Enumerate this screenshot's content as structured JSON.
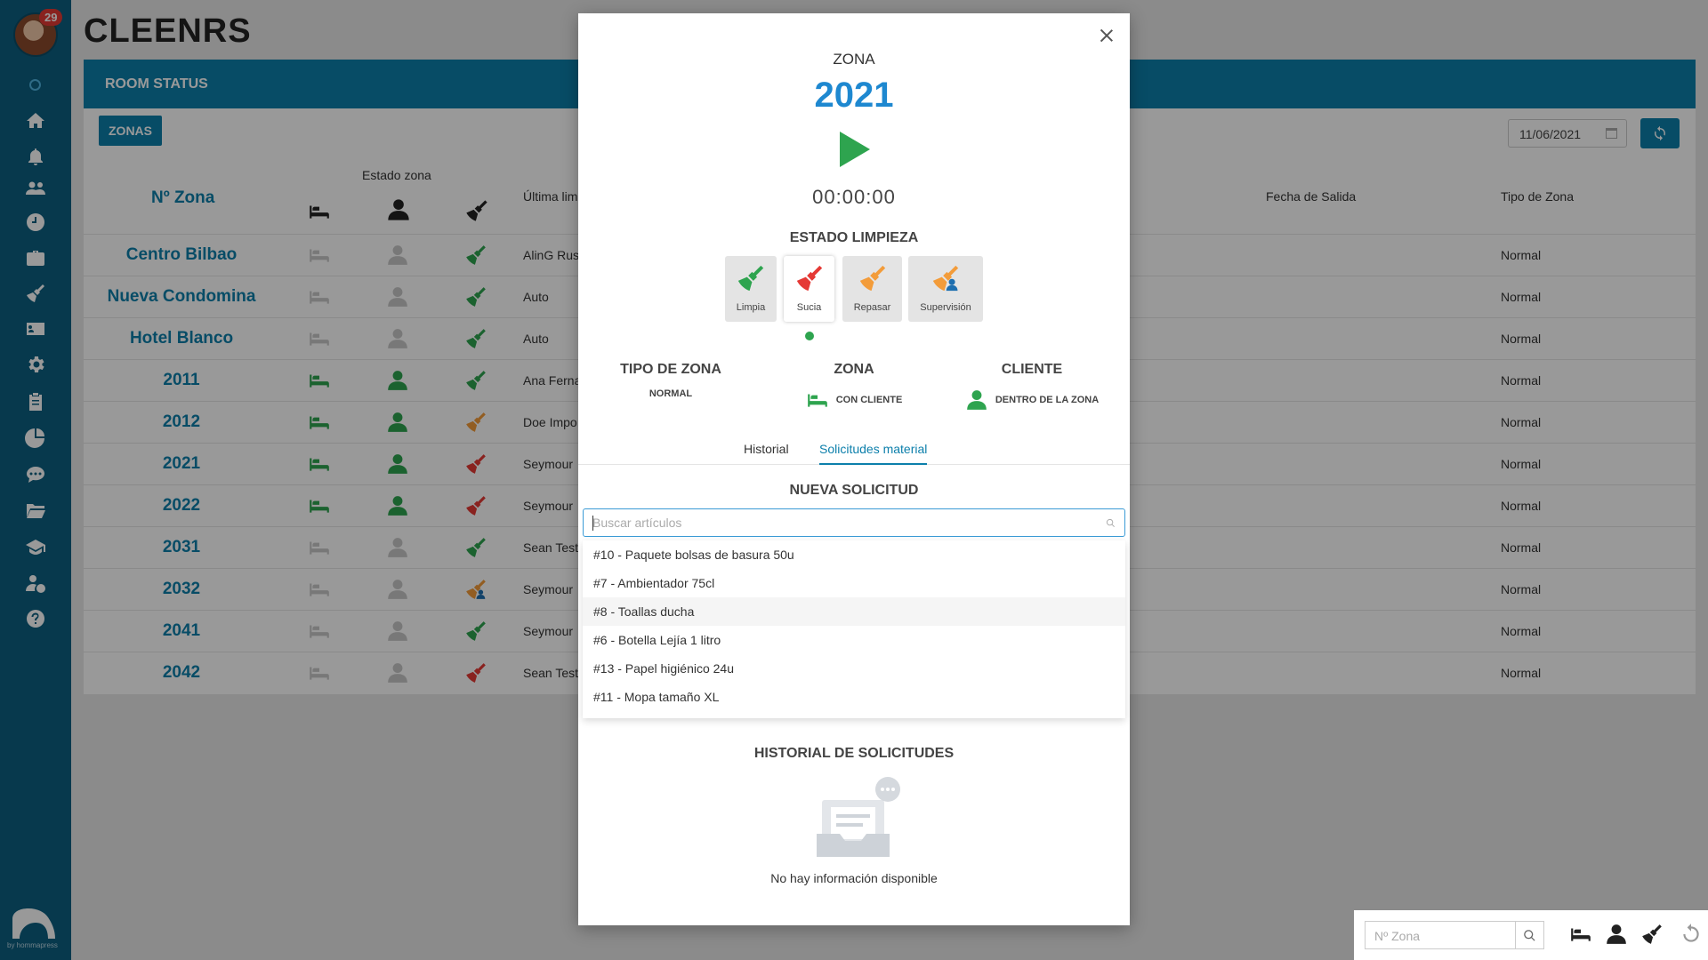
{
  "app": {
    "title": "CLEENRS",
    "notifications_count": "29",
    "vendor": "by hommapress"
  },
  "panel": {
    "title": "ROOM STATUS",
    "zonas_button": "ZONAS",
    "date": "11/06/2021"
  },
  "table": {
    "headers": {
      "zona": "Nº Zona",
      "estado_zona": "Estado zona",
      "ultima": "Última lim",
      "fecha_salida": "Fecha de Salida",
      "tipo_zona": "Tipo de Zona"
    },
    "rows": [
      {
        "zona": "Centro Bilbao",
        "bed": "inactive",
        "person": "inactive",
        "clean": "green",
        "ultima": "AlinG Rus",
        "tipo": "Normal"
      },
      {
        "zona": "Nueva Condomina",
        "bed": "inactive",
        "person": "inactive",
        "clean": "green",
        "ultima": "Auto",
        "tipo": "Normal"
      },
      {
        "zona": "Hotel Blanco",
        "bed": "inactive",
        "person": "inactive",
        "clean": "green",
        "ultima": "Auto",
        "tipo": "Normal"
      },
      {
        "zona": "2011",
        "bed": "active",
        "person": "active",
        "clean": "green",
        "ultima": "Ana Ferna",
        "tipo": "Normal"
      },
      {
        "zona": "2012",
        "bed": "active",
        "person": "active",
        "clean": "orange",
        "ultima": "Doe Impo",
        "tipo": "Normal"
      },
      {
        "zona": "2021",
        "bed": "active",
        "person": "active",
        "clean": "red",
        "ultima": "Seymour",
        "tipo": "Normal"
      },
      {
        "zona": "2022",
        "bed": "active",
        "person": "active",
        "clean": "red",
        "ultima": "Seymour",
        "tipo": "Normal"
      },
      {
        "zona": "2031",
        "bed": "inactive",
        "person": "inactive",
        "clean": "green",
        "ultima": "Sean Test",
        "tipo": "Normal"
      },
      {
        "zona": "2032",
        "bed": "inactive",
        "person": "inactive",
        "clean": "orange-blue",
        "ultima": "Seymour",
        "tipo": "Normal"
      },
      {
        "zona": "2041",
        "bed": "inactive",
        "person": "inactive",
        "clean": "green",
        "ultima": "Seymour",
        "tipo": "Normal"
      },
      {
        "zona": "2042",
        "bed": "inactive",
        "person": "inactive",
        "clean": "red",
        "ultima": "Sean Test",
        "tipo": "Normal"
      }
    ]
  },
  "filter": {
    "placeholder": "Nº Zona"
  },
  "modal": {
    "zona_label": "ZONA",
    "zona_number": "2021",
    "timer": "00:00:00",
    "estado_title": "ESTADO LIMPIEZA",
    "estado_options": [
      "Limpia",
      "Sucia",
      "Repasar",
      "Supervisión"
    ],
    "estado_selected": "Sucia",
    "tipo_zona_label": "TIPO DE ZONA",
    "tipo_zona_value": "NORMAL",
    "zona_status_label": "ZONA",
    "zona_status_value": "CON CLIENTE",
    "cliente_label": "CLIENTE",
    "cliente_value": "DENTRO DE LA ZONA",
    "tabs": [
      "Historial",
      "Solicitudes material"
    ],
    "active_tab": "Solicitudes material",
    "nueva_title": "NUEVA SOLICITUD",
    "search_placeholder": "Buscar artículos",
    "articles": [
      "#10 - Paquete bolsas de basura 50u",
      "#7 - Ambientador 75cl",
      "#8 - Toallas ducha",
      "#6 - Botella Lejía 1 litro",
      "#13 - Papel higiénico 24u",
      "#11 - Mopa tamaño XL"
    ],
    "highlighted_article": "#8 - Toallas ducha",
    "historial_title": "HISTORIAL DE SOLICITUDES",
    "empty_text": "No hay información disponible"
  },
  "colors": {
    "primary": "#0c7fab",
    "sidebar": "#0c5f80",
    "green": "#2ea44f",
    "red": "#e53935",
    "orange": "#f39c3a",
    "blue_number": "#1e88d0"
  },
  "icons": {
    "sidebar": [
      "home-icon",
      "bell-icon",
      "users-icon",
      "clock-icon",
      "briefcase-icon",
      "broom-icon",
      "id-card-icon",
      "gear-icon",
      "clipboard-icon",
      "pie-chart-icon",
      "chat-icon",
      "folder-icon",
      "graduation-cap-icon",
      "user-info-icon",
      "help-icon"
    ]
  }
}
